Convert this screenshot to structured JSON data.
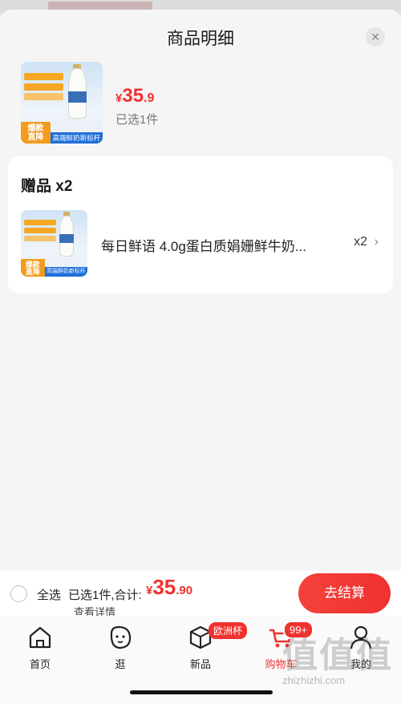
{
  "sheet": {
    "title": "商品明细",
    "close_icon": "close-icon"
  },
  "product": {
    "price_currency": "¥",
    "price_integer": "35",
    "price_decimal": ".9",
    "selected_count": "已选1件",
    "thumb_tag": "爆款\n直降",
    "thumb_strip": "高端鲜奶新标杆"
  },
  "gift": {
    "title": "赠品 x2",
    "name": "每日鲜语 4.0g蛋白质娟姗鲜牛奶...",
    "qty": "x2",
    "chevron": "›",
    "thumb_tag": "爆款\n直降",
    "thumb_strip": "高端鲜奶新标杆"
  },
  "checkout": {
    "select_all": "全选",
    "summary": "已选1件,合计:",
    "total_currency": "¥",
    "total_integer": "35",
    "total_decimal": ".90",
    "details": "查看详情",
    "button": "去结算"
  },
  "tabbar": {
    "items": [
      {
        "label": "首页",
        "icon": "home-icon"
      },
      {
        "label": "逛",
        "icon": "browse-face-icon"
      },
      {
        "label": "新品",
        "icon": "new-box-icon"
      },
      {
        "label": "购物车",
        "icon": "cart-icon"
      },
      {
        "label": "我的",
        "icon": "profile-icon"
      }
    ],
    "badge_new": "欧洲杯",
    "badge_cart": "99+"
  },
  "watermark": {
    "glyphs": "值值值",
    "text": "zhizhizhi.com"
  },
  "colors": {
    "accent": "#f0322f",
    "sheet_bg": "#f5f5f5",
    "card_bg": "#ffffff"
  }
}
